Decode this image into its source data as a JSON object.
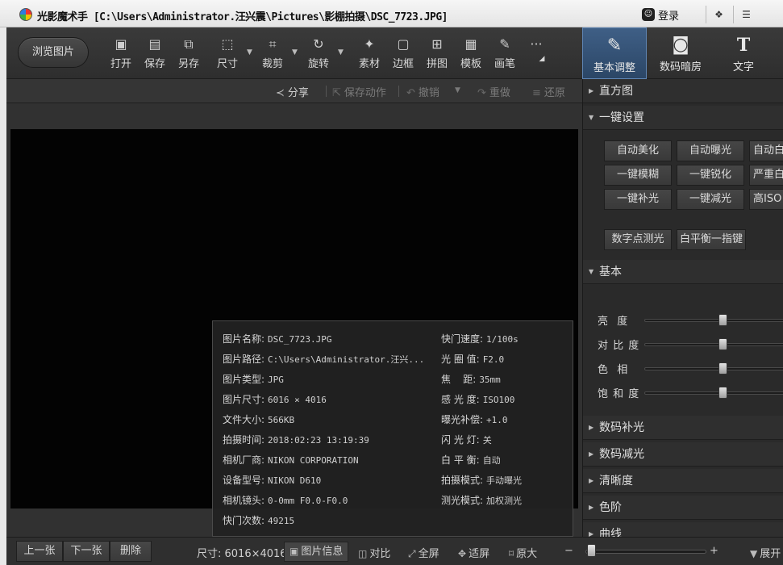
{
  "window": {
    "title": "光影魔术手  [C:\\Users\\Administrator.汪兴震\\Pictures\\影棚拍摄\\DSC_7723.JPG]",
    "login_label": "登录",
    "controls": [
      "skin",
      "menu"
    ]
  },
  "toolbar": {
    "browse_label": "浏览图片",
    "tools": [
      {
        "label": "打开",
        "icon": "open-icon"
      },
      {
        "label": "保存",
        "icon": "save-icon"
      },
      {
        "label": "另存",
        "icon": "save-as-icon"
      },
      {
        "label": "尺寸",
        "icon": "resize-icon"
      },
      {
        "label": "裁剪",
        "icon": "crop-icon"
      },
      {
        "label": "旋转",
        "icon": "rotate-icon"
      },
      {
        "label": "素材",
        "icon": "material-icon"
      },
      {
        "label": "边框",
        "icon": "border-icon"
      },
      {
        "label": "拼图",
        "icon": "collage-icon"
      },
      {
        "label": "模板",
        "icon": "template-icon"
      },
      {
        "label": "画笔",
        "icon": "brush-icon"
      }
    ],
    "more_label": "···",
    "big_tabs": [
      {
        "label": "基本调整",
        "icon": "adjust-icon",
        "active": true
      },
      {
        "label": "数码暗房",
        "icon": "darkroom-icon",
        "active": false
      },
      {
        "label": "文字",
        "icon": "text-icon",
        "active": false
      }
    ]
  },
  "subbar": {
    "share": "分享",
    "save_action": "保存动作",
    "undo": "撤销",
    "redo": "重做",
    "restore": "还原"
  },
  "info": {
    "left": [
      {
        "k": "图片名称:",
        "v": "DSC_7723.JPG"
      },
      {
        "k": "图片路径:",
        "v": "C:\\Users\\Administrator.汪兴..."
      },
      {
        "k": "图片类型:",
        "v": "JPG"
      },
      {
        "k": "图片尺寸:",
        "v": "6016 × 4016"
      },
      {
        "k": "文件大小:",
        "v": "566KB"
      },
      {
        "k": "拍摄时间:",
        "v": "2018:02:23 13:19:39"
      },
      {
        "k": "相机厂商:",
        "v": "NIKON CORPORATION"
      },
      {
        "k": "设备型号:",
        "v": "NIKON D610"
      },
      {
        "k": "相机镜头:",
        "v": "0-0mm  F0.0-F0.0"
      },
      {
        "k": "快门次数:",
        "v": "49215"
      }
    ],
    "right": [
      {
        "k": "快门速度:",
        "v": "1/100s"
      },
      {
        "k": "光 圈 值:",
        "v": "F2.0"
      },
      {
        "k": "焦    距:",
        "v": "35mm"
      },
      {
        "k": "感 光 度:",
        "v": "ISO100"
      },
      {
        "k": "曝光补偿:",
        "v": "+1.0"
      },
      {
        "k": "闪 光 灯:",
        "v": "关"
      },
      {
        "k": "白 平 衡:",
        "v": "自动"
      },
      {
        "k": "拍摄模式:",
        "v": "手动曝光"
      },
      {
        "k": "测光模式:",
        "v": "加权测光"
      }
    ]
  },
  "bottom": {
    "prev": "上一张",
    "next": "下一张",
    "delete": "删除",
    "size_label": "尺寸: 6016×4016",
    "pic_info": "图片信息",
    "compare": "对比",
    "fullscreen": "全屏",
    "fit": "适屏",
    "original": "原大",
    "zoom_minus": "−",
    "zoom_plus": "+",
    "zoom_level": 0.02,
    "expand": "展开"
  },
  "panel": {
    "histogram": "直方图",
    "one_click": "一键设置",
    "buttons_row1": [
      "自动美化",
      "自动曝光",
      "自动白"
    ],
    "buttons_row2": [
      "一键模糊",
      "一键锐化",
      "严重白"
    ],
    "buttons_row3": [
      "一键补光",
      "一键减光",
      "高ISO"
    ],
    "buttons_row4": [
      "数字点测光",
      "白平衡一指键"
    ],
    "basic": "基本",
    "sliders": [
      {
        "label": "亮  度",
        "value": 0.5
      },
      {
        "label": "对 比 度",
        "value": 0.5
      },
      {
        "label": "色  相",
        "value": 0.5
      },
      {
        "label": "饱 和 度",
        "value": 0.5
      }
    ],
    "sections": [
      "数码补光",
      "数码减光",
      "清晰度",
      "色阶",
      "曲线"
    ]
  },
  "colors": {
    "accent": "#3f5f86",
    "panel_bg": "#2a2a2a",
    "photo_bg": "#030303"
  }
}
